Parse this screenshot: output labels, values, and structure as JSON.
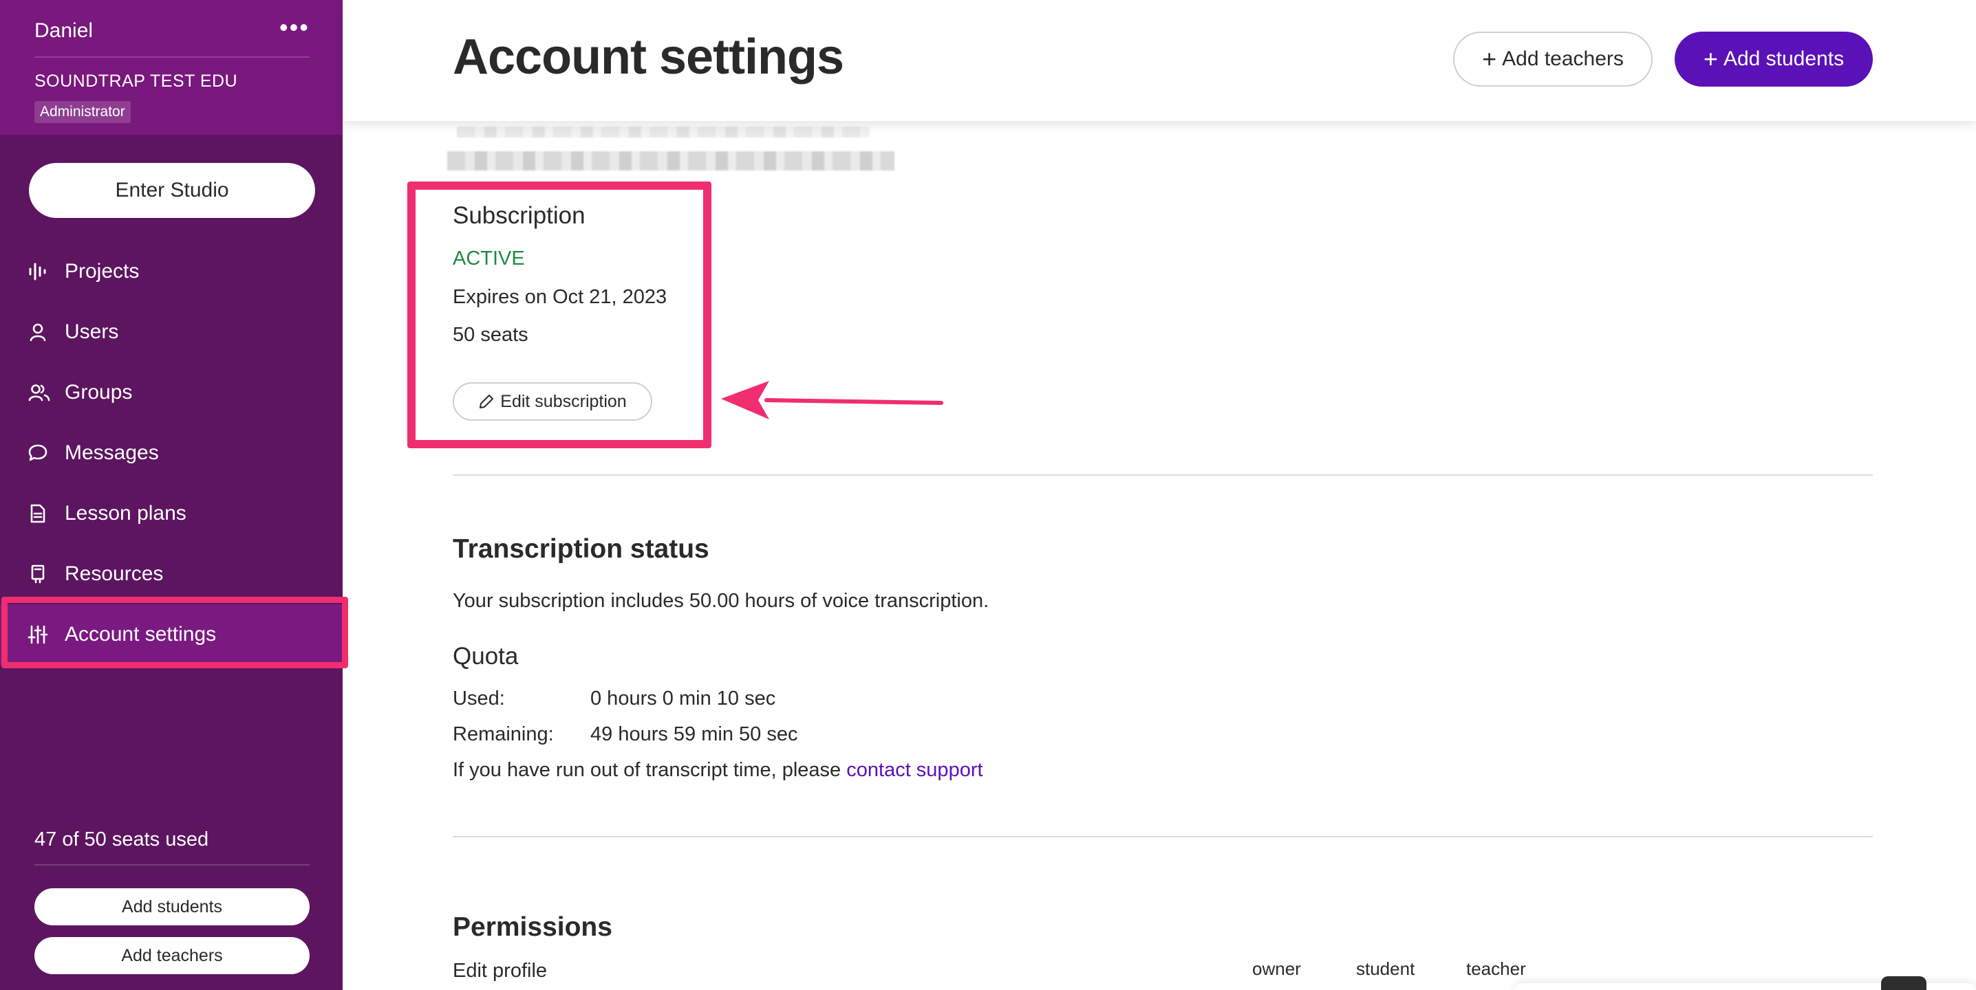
{
  "sidebar": {
    "user_name": "Daniel",
    "more_label": "•••",
    "org_name": "SOUNDTRAP TEST EDU",
    "role": "Administrator",
    "enter_studio": "Enter Studio",
    "items": [
      {
        "label": "Projects",
        "icon": "projects-icon"
      },
      {
        "label": "Users",
        "icon": "user-icon"
      },
      {
        "label": "Groups",
        "icon": "groups-icon"
      },
      {
        "label": "Messages",
        "icon": "chat-bubble-icon"
      },
      {
        "label": "Lesson plans",
        "icon": "document-icon"
      },
      {
        "label": "Resources",
        "icon": "bookmark-icon"
      },
      {
        "label": "Account settings",
        "icon": "sliders-icon",
        "active": true
      }
    ],
    "seats_used": "47 of 50 seats used",
    "add_students": "Add students",
    "add_teachers": "Add teachers"
  },
  "header": {
    "title": "Account settings",
    "add_teachers": "Add teachers",
    "add_students": "Add students"
  },
  "subscription": {
    "title": "Subscription",
    "status": "ACTIVE",
    "expires": "Expires on Oct 21, 2023",
    "seats": "50 seats",
    "edit_button": "Edit subscription"
  },
  "transcription": {
    "title": "Transcription status",
    "description": "Your subscription includes 50.00 hours of voice transcription.",
    "quota_title": "Quota",
    "used_label": "Used:",
    "used_value": "0 hours 0 min 10 sec",
    "remaining_label": "Remaining:",
    "remaining_value": "49 hours 59 min 50 sec",
    "support_text": "If you have run out of transcript time, please",
    "support_link": "contact support"
  },
  "permissions": {
    "title": "Permissions",
    "first_row": "Edit profile",
    "columns": [
      "owner",
      "student",
      "teacher"
    ]
  },
  "colors": {
    "sidebar_bg": "#5d1560",
    "sidebar_header_bg": "#79187d",
    "primary": "#5a11b8",
    "highlight": "#f02e6e",
    "active_status": "#1e8a43"
  }
}
